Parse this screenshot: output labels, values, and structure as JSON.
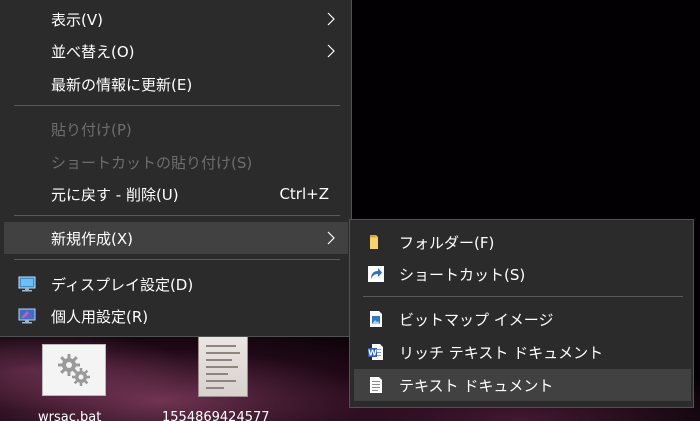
{
  "menu": {
    "items": [
      {
        "label": "表示(V)",
        "has_submenu": true
      },
      {
        "label": "並べ替え(O)",
        "has_submenu": true
      },
      {
        "label": "最新の情報に更新(E)"
      },
      {
        "label": "貼り付け(P)",
        "disabled": true
      },
      {
        "label": "ショートカットの貼り付け(S)",
        "disabled": true
      },
      {
        "label": "元に戻す - 削除(U)",
        "shortcut": "Ctrl+Z"
      },
      {
        "label": "新規作成(X)",
        "has_submenu": true,
        "highlighted": true
      },
      {
        "label": "ディスプレイ設定(D)",
        "icon": "display-icon"
      },
      {
        "label": "個人用設定(R)",
        "icon": "personalize-icon"
      }
    ]
  },
  "submenu": {
    "items": [
      {
        "label": "フォルダー(F)",
        "icon": "folder-icon"
      },
      {
        "label": "ショートカット(S)",
        "icon": "shortcut-icon"
      },
      {
        "label": "ビットマップ イメージ",
        "icon": "bitmap-image-icon"
      },
      {
        "label": "リッチ テキスト ドキュメント",
        "icon": "word-document-icon"
      },
      {
        "label": "テキスト ドキュメント",
        "icon": "text-document-icon",
        "highlighted": true
      }
    ]
  },
  "desktop": {
    "icons": [
      {
        "label": "wrsac.bat",
        "icon": "batch-file-gear-icon"
      },
      {
        "label": "1554869424577",
        "icon": "image-thumbnail-icon"
      }
    ]
  },
  "colors": {
    "menu_bg": "#2b2b2b",
    "menu_hover": "#414141",
    "text": "#ffffff",
    "disabled_text": "#6d6d6d",
    "separator": "#5a5a5a"
  }
}
